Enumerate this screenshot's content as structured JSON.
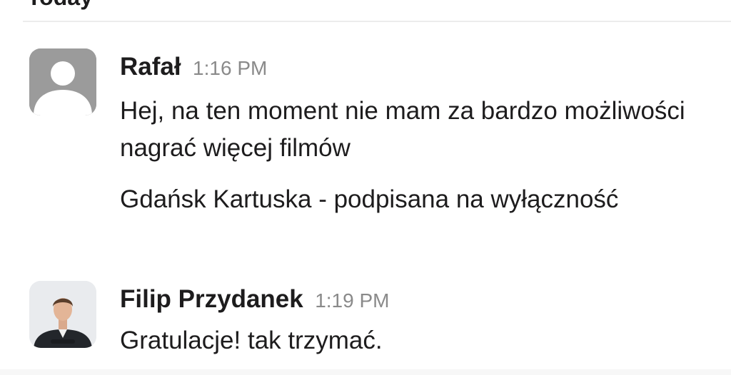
{
  "day_divider": {
    "label": "Today"
  },
  "messages": [
    {
      "sender": "Rafał",
      "time": "1:16 PM",
      "avatar_icon": "default-user-avatar-icon",
      "paragraphs": [
        "Hej, na ten moment nie mam za bardzo możliwości nagrać więcej filmów",
        "Gdańsk Kartuska - podpisana na wyłączność"
      ]
    },
    {
      "sender": "Filip Przydanek",
      "time": "1:19 PM",
      "avatar_icon": "user-photo-avatar",
      "paragraphs": [
        "Gratulacje! tak trzymać."
      ]
    }
  ],
  "colors": {
    "text": "#1d1c1d",
    "timestamp": "#8a8a8a",
    "default_avatar": "#9b9b9b",
    "divider": "#ececec"
  }
}
